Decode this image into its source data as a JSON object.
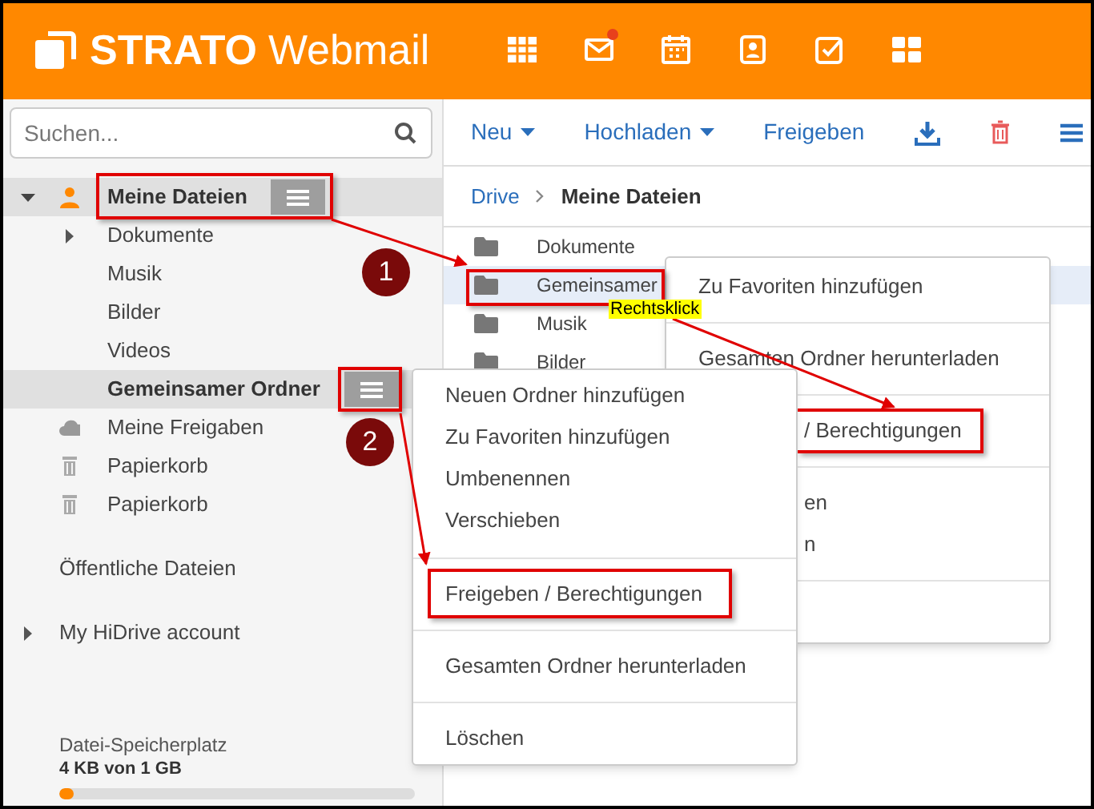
{
  "header": {
    "logo": {
      "brand": "STRATO",
      "product": "Webmail"
    },
    "apps": [
      {
        "kind": "grid",
        "notification": false
      },
      {
        "kind": "mail",
        "notification": true
      },
      {
        "kind": "calendar",
        "notification": false
      },
      {
        "kind": "contacts",
        "notification": false
      },
      {
        "kind": "tasks",
        "notification": false
      },
      {
        "kind": "tiles",
        "notification": false
      }
    ]
  },
  "sidebar": {
    "search": {
      "placeholder": "Suchen..."
    },
    "tree": [
      {
        "label": "Meine Dateien",
        "kind": "user",
        "expanded": true,
        "selected": true,
        "menu_button": true,
        "children": [
          {
            "label": "Dokumente",
            "expanded": false,
            "selected": false,
            "menu_button": false
          },
          {
            "label": "Musik",
            "selected": false,
            "menu_button": false
          },
          {
            "label": "Bilder",
            "selected": false,
            "menu_button": false
          },
          {
            "label": "Videos",
            "selected": false,
            "menu_button": false
          },
          {
            "label": "Gemeinsamer Ordner",
            "selected": true,
            "menu_button": true
          }
        ]
      },
      {
        "label": "Meine Freigaben",
        "kind": "cloud",
        "selected": false,
        "menu_button": false
      },
      {
        "label": "Papierkorb",
        "kind": "trash",
        "selected": false,
        "menu_button": false
      },
      {
        "label": "Papierkorb",
        "kind": "trash",
        "selected": false,
        "menu_button": false
      }
    ],
    "sections": [
      {
        "label": "Öffentliche Dateien"
      },
      {
        "label": "My HiDrive account",
        "expanded": false
      }
    ],
    "storage": {
      "label": "Datei-Speicherplatz",
      "value": "4 KB von 1 GB",
      "level": 0.04
    }
  },
  "toolbar": [
    {
      "kind": "dropdown",
      "label": "Neu"
    },
    {
      "kind": "dropdown",
      "label": "Hochladen"
    },
    {
      "kind": "button",
      "label": "Freigeben"
    },
    {
      "kind": "download"
    },
    {
      "kind": "trash"
    },
    {
      "kind": "menu"
    }
  ],
  "breadcrumb": [
    "Drive",
    "Meine Dateien"
  ],
  "files": [
    {
      "name": "Dokumente",
      "selected": false
    },
    {
      "name": "Gemeinsamer",
      "selected": true
    },
    {
      "name": "Musik",
      "selected": false
    },
    {
      "name": "Bilder",
      "selected": false
    }
  ],
  "context_menus": [
    {
      "groups": [
        [
          {
            "label": "Zu Favoriten hinzufügen",
            "clipped": false
          }
        ],
        [
          {
            "label": "Gesamten Ordner herunterladen",
            "clipped": false
          }
        ],
        [
          {
            "label": "/ Berechtigungen",
            "clipped": true
          }
        ],
        [
          {
            "label": "en",
            "clipped": true
          },
          {
            "label": "n",
            "clipped": true
          }
        ]
      ]
    },
    {
      "groups": [
        [
          {
            "label": "Neuen Ordner hinzufügen",
            "clipped": false
          },
          {
            "label": "Zu Favoriten hinzufügen",
            "clipped": false
          },
          {
            "label": "Umbenennen",
            "clipped": false
          },
          {
            "label": "Verschieben",
            "clipped": false
          }
        ],
        [
          {
            "label": "Freigeben / Berechtigungen",
            "clipped": false
          }
        ],
        [
          {
            "label": "Gesamten Ordner herunterladen",
            "clipped": false
          }
        ],
        [
          {
            "label": "Löschen",
            "clipped": false
          }
        ]
      ]
    }
  ],
  "annotations": {
    "steps": [
      "1",
      "2"
    ],
    "callout": "Rechtsklick"
  }
}
